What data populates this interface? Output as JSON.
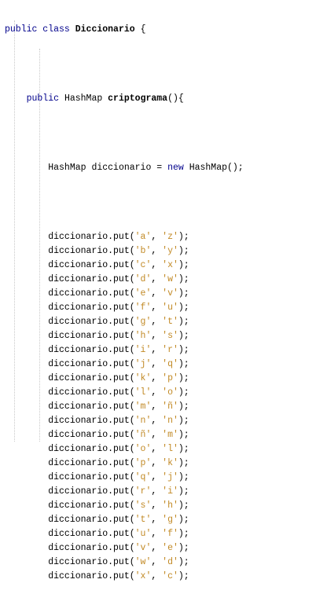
{
  "class_decl": {
    "keywords": "public class",
    "name": "Diccionario",
    "brace": "{"
  },
  "method_decl": {
    "keyword": "public",
    "return_type": "HashMap",
    "name": "criptograma",
    "signature_end": "(){"
  },
  "init": {
    "type": "HashMap",
    "var_assign": "diccionario =",
    "keyword_new": "new",
    "ctor": "HashMap();"
  },
  "put_prefix": "diccionario.put(",
  "put_sep": ", ",
  "put_end": ");",
  "puts": [
    {
      "key": "'a'",
      "value": "'z'"
    },
    {
      "key": "'b'",
      "value": "'y'"
    },
    {
      "key": "'c'",
      "value": "'x'"
    },
    {
      "key": "'d'",
      "value": "'w'"
    },
    {
      "key": "'e'",
      "value": "'v'"
    },
    {
      "key": "'f'",
      "value": "'u'"
    },
    {
      "key": "'g'",
      "value": "'t'"
    },
    {
      "key": "'h'",
      "value": "'s'"
    },
    {
      "key": "'i'",
      "value": "'r'"
    },
    {
      "key": "'j'",
      "value": "'q'"
    },
    {
      "key": "'k'",
      "value": "'p'"
    },
    {
      "key": "'l'",
      "value": "'o'"
    },
    {
      "key": "'m'",
      "value": "'ñ'"
    },
    {
      "key": "'n'",
      "value": "'n'"
    },
    {
      "key": "'ñ'",
      "value": "'m'"
    },
    {
      "key": "'o'",
      "value": "'l'"
    },
    {
      "key": "'p'",
      "value": "'k'"
    },
    {
      "key": "'q'",
      "value": "'j'"
    },
    {
      "key": "'r'",
      "value": "'i'"
    },
    {
      "key": "'s'",
      "value": "'h'"
    },
    {
      "key": "'t'",
      "value": "'g'"
    },
    {
      "key": "'u'",
      "value": "'f'"
    },
    {
      "key": "'v'",
      "value": "'e'"
    },
    {
      "key": "'w'",
      "value": "'d'"
    },
    {
      "key": "'x'",
      "value": "'c'"
    }
  ],
  "colors": {
    "keyword": "#00008b",
    "string": "#c28a26",
    "text": "#000000",
    "background": "#ffffff"
  }
}
